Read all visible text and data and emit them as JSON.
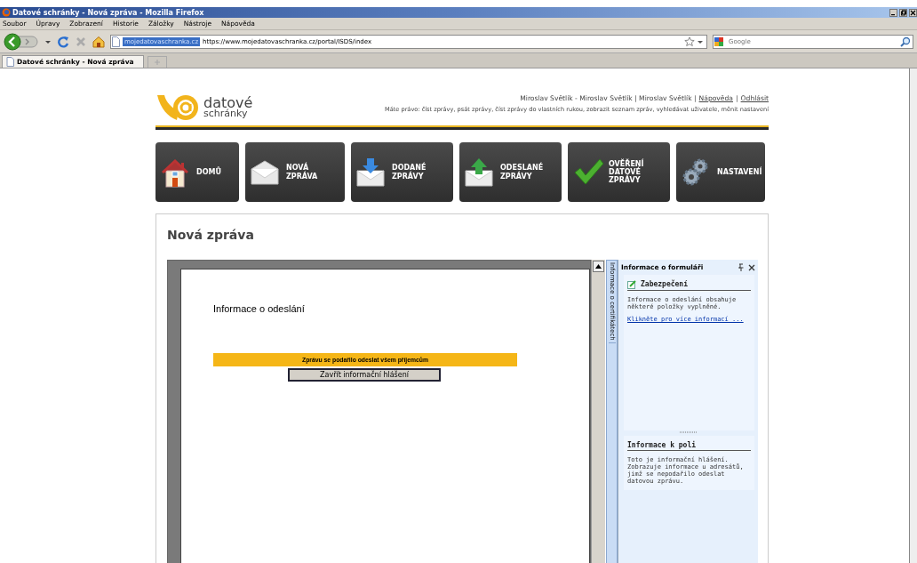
{
  "window": {
    "title": "Datové schránky - Nová zpráva - Mozilla Firefox"
  },
  "menu": [
    "Soubor",
    "Úpravy",
    "Zobrazení",
    "Historie",
    "Záložky",
    "Nástroje",
    "Nápověda"
  ],
  "address_bar": {
    "site": "mojedatovaschranka.cz",
    "url": "https://www.mojedatovaschranka.cz/portal/ISDS/index"
  },
  "search": {
    "placeholder": "Google"
  },
  "tabs": [
    {
      "label": "Datové schránky - Nová zpráva",
      "selected": true
    }
  ],
  "page": {
    "logo": {
      "line_1": "datové",
      "line_2": "schránky"
    },
    "user": {
      "names": "Miroslav Světlík - Miroslav Světlík | Miroslav Světlík |",
      "links": [
        "Nápověda",
        "Odhlásit"
      ],
      "separator": "|"
    },
    "rights": "Máte právo: číst zprávy, psát zprávy, číst zprávy do vlastních rukou, zobrazit seznam zpráv, vyhledávat uživatele, měnit nastavení",
    "nav": [
      {
        "kind": "home",
        "lines": [
          "DOMŮ"
        ]
      },
      {
        "kind": "new",
        "lines": [
          "NOVÁ",
          "ZPRÁVA"
        ]
      },
      {
        "kind": "inbox",
        "lines": [
          "DODANÉ",
          "ZPRÁVY"
        ]
      },
      {
        "kind": "sent",
        "lines": [
          "ODESLANÉ",
          "ZPRÁVY"
        ]
      },
      {
        "kind": "verify",
        "lines": [
          "OVĚŘENÍ",
          "DATOVÉ",
          "ZPRÁVY"
        ]
      },
      {
        "kind": "settings",
        "lines": [
          "NASTAVENÍ"
        ]
      }
    ],
    "heading": "Nová zpráva",
    "form": {
      "title": "Informace o odeslání",
      "banner": "Zprávu se podařilo odeslat všem příjemcům",
      "close_button": "Zavřít informační hlášení"
    },
    "side_tab": "Informace o certifikátech",
    "side_panel": {
      "title": "Informace o formuláři",
      "sections": [
        {
          "title": "Zabezpečení",
          "icon": true,
          "text": "Informace o odeslání obsahuje některé položky vyplněné.",
          "link": "Klikněte pro více informací ..."
        },
        {
          "title": "Informace k poli",
          "icon": false,
          "text": "Toto je informační hlášení. Zobrazuje informace u adresátů, jimž se nepodařilo odeslat datovou zprávu."
        }
      ]
    }
  }
}
